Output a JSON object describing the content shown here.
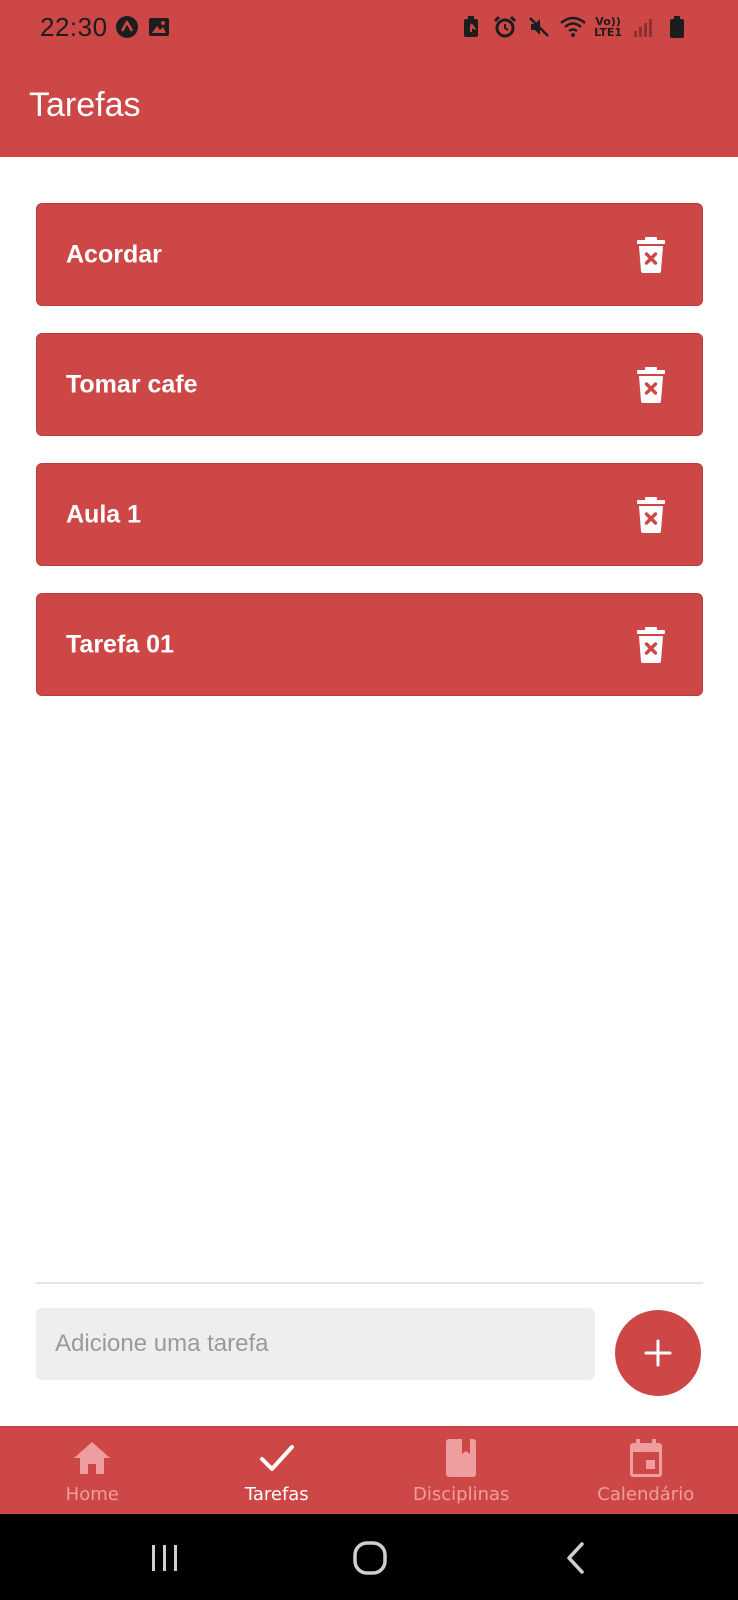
{
  "status_bar": {
    "time": "22:30",
    "left_icons": [
      "app-notification-icon",
      "image-icon"
    ],
    "right_icons": [
      "battery-saver-icon",
      "alarm-icon",
      "mute-icon",
      "wifi-icon",
      "volte-icon",
      "signal-icon",
      "battery-icon"
    ],
    "volte_text": "Vo))",
    "lte_text": "LTE1"
  },
  "app_bar": {
    "title": "Tarefas"
  },
  "tasks": [
    {
      "label": "Acordar",
      "delete_icon": "delete-icon"
    },
    {
      "label": "Tomar cafe",
      "delete_icon": "delete-icon"
    },
    {
      "label": "Aula 1",
      "delete_icon": "delete-icon"
    },
    {
      "label": "Tarefa 01",
      "delete_icon": "delete-icon"
    }
  ],
  "input": {
    "value": "",
    "placeholder": "Adicione uma tarefa"
  },
  "add_button": {
    "icon": "plus-icon"
  },
  "bottom_nav": {
    "items": [
      {
        "label": "Home",
        "icon": "home-icon",
        "active": false
      },
      {
        "label": "Tarefas",
        "icon": "check-icon",
        "active": true
      },
      {
        "label": "Disciplinas",
        "icon": "book-icon",
        "active": false
      },
      {
        "label": "Calendário",
        "icon": "calendar-icon",
        "active": false
      }
    ]
  },
  "system_nav": {
    "buttons": [
      "recent-apps-icon",
      "home-button-icon",
      "back-icon"
    ]
  },
  "colors": {
    "primary": "#cd4747",
    "inactive_nav": "#ee9e9e",
    "input_bg": "#eeeeee",
    "system_bar": "#000000"
  }
}
